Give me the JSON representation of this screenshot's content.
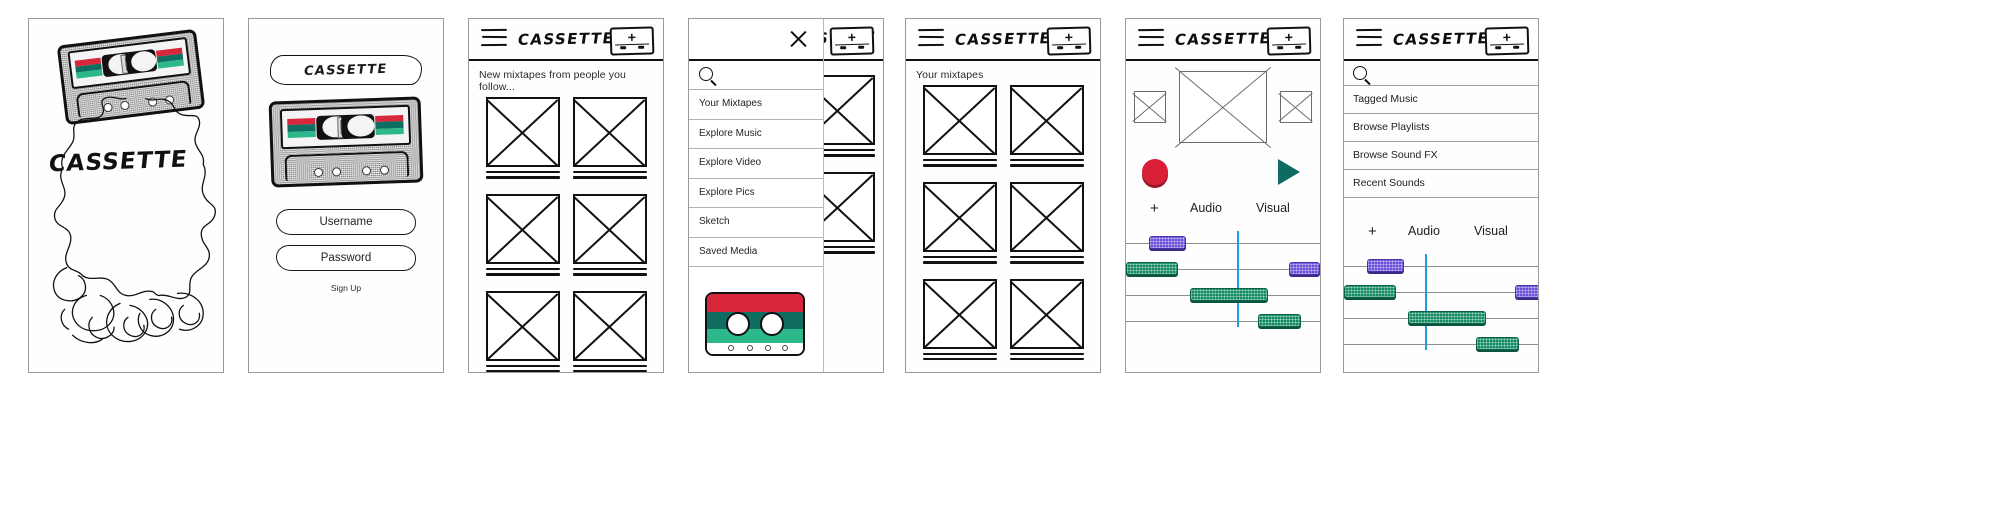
{
  "app": {
    "name": "CASSETTE",
    "wordmark": "CASSETTE"
  },
  "colors": {
    "record_red": "#d81f35",
    "play_green": "#0e6b63",
    "clip_purple": "#6b4fd8",
    "clip_green": "#128a63",
    "playhead_blue": "#1e9fd8",
    "tape_stripe_red": "#d8273b",
    "tape_stripe_teal": "#0f6d62",
    "tape_stripe_green": "#2cb88a"
  },
  "panel1_splash": {
    "name": "splash-screen",
    "brand": "CASSETTE",
    "artwork": "cassette-tape-illustration",
    "doodle": "hand-drawn-scribble"
  },
  "panel2_login": {
    "name": "login-screen",
    "logo_label": "CASSETTE",
    "username_value": "Username",
    "username_placeholder": "Username",
    "password_value": "Password",
    "password_placeholder": "Password",
    "signup_label": "Sign Up"
  },
  "panel3_feed": {
    "name": "feed-screen",
    "menu_icon": "hamburger-icon",
    "title": "CASSETTE",
    "new_mixtape_icon": "new-cassette-plus-icon",
    "caption": "New mixtapes from people you follow...",
    "cards": [
      {
        "thumb": "placeholder-image"
      },
      {
        "thumb": "placeholder-image"
      },
      {
        "thumb": "placeholder-image"
      },
      {
        "thumb": "placeholder-image"
      },
      {
        "thumb": "placeholder-image"
      },
      {
        "thumb": "placeholder-image"
      }
    ]
  },
  "panel4_menu": {
    "name": "navigation-drawer",
    "close_icon": "close-x-icon",
    "search_icon": "search-icon",
    "search_value": "",
    "search_placeholder": "",
    "items": [
      {
        "label": "Your Mixtapes"
      },
      {
        "label": "Explore Music"
      },
      {
        "label": "Explore Video"
      },
      {
        "label": "Explore Pics"
      },
      {
        "label": "Sketch"
      },
      {
        "label": "Saved Media"
      }
    ],
    "footer_art": "cassette-tape-icon",
    "behind_title": "CASSETTE",
    "behind_new_icon": "new-cassette-plus-icon"
  },
  "panel5_mixtapes": {
    "name": "your-mixtapes-screen",
    "menu_icon": "hamburger-icon",
    "title": "CASSETTE",
    "new_mixtape_icon": "new-cassette-plus-icon",
    "caption": "Your mixtapes",
    "cards": [
      {
        "thumb": "placeholder-image"
      },
      {
        "thumb": "placeholder-image"
      },
      {
        "thumb": "placeholder-image"
      },
      {
        "thumb": "placeholder-image"
      },
      {
        "thumb": "placeholder-image"
      },
      {
        "thumb": "placeholder-image"
      }
    ]
  },
  "panel6_editor": {
    "name": "mixtape-editor-screen",
    "menu_icon": "hamburger-icon",
    "title": "CASSETTE",
    "new_mixtape_icon": "new-cassette-plus-icon",
    "preview_left": "placeholder-image",
    "preview_main": "placeholder-image",
    "preview_right": "placeholder-image",
    "record_button": "record-button",
    "play_button": "play-button",
    "add_track_label": "+",
    "tab_audio": "Audio",
    "tab_visual": "Visual",
    "clips": [
      {
        "track": 1,
        "type": "purple",
        "left_pct": 12,
        "width_pct": 19
      },
      {
        "track": 2,
        "type": "green",
        "left_pct": 0,
        "width_pct": 27
      },
      {
        "track": 2,
        "type": "purple",
        "left_pct": 84,
        "width_pct": 16
      },
      {
        "track": 3,
        "type": "green",
        "left_pct": 33,
        "width_pct": 40
      },
      {
        "track": 4,
        "type": "green",
        "left_pct": 68,
        "width_pct": 22
      }
    ],
    "playhead_pct": 57
  },
  "panel7_sound_picker": {
    "name": "sound-picker-screen",
    "menu_icon": "hamburger-icon",
    "title": "CASSETTE",
    "new_mixtape_icon": "new-cassette-plus-icon",
    "search_icon": "search-icon",
    "search_value": "",
    "search_placeholder": "",
    "items": [
      {
        "label": "Tagged Music"
      },
      {
        "label": "Browse Playlists"
      },
      {
        "label": "Browse Sound FX"
      },
      {
        "label": "Recent Sounds"
      }
    ],
    "add_track_label": "+",
    "tab_audio": "Audio",
    "tab_visual": "Visual",
    "clips": [
      {
        "track": 1,
        "type": "purple",
        "left_pct": 12,
        "width_pct": 19
      },
      {
        "track": 2,
        "type": "green",
        "left_pct": 0,
        "width_pct": 27
      },
      {
        "track": 2,
        "type": "purple",
        "left_pct": 88,
        "width_pct": 14
      },
      {
        "track": 3,
        "type": "green",
        "left_pct": 33,
        "width_pct": 40
      },
      {
        "track": 4,
        "type": "green",
        "left_pct": 68,
        "width_pct": 22
      }
    ],
    "playhead_pct": 42
  }
}
